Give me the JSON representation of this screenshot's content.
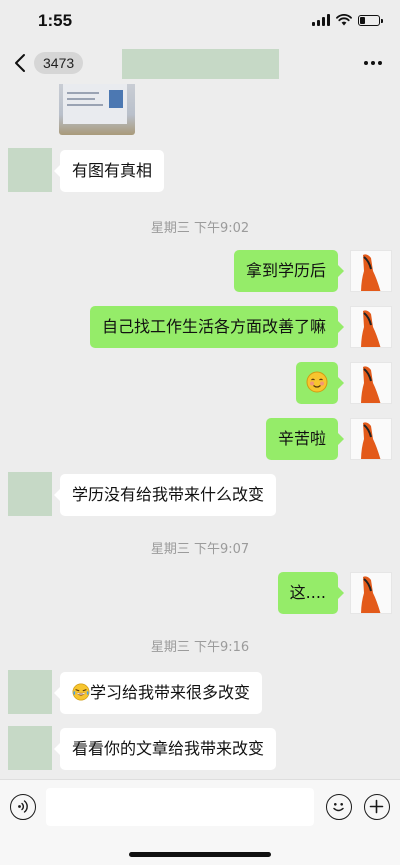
{
  "status_bar": {
    "time": "1:55",
    "battery_level": 0.3
  },
  "nav": {
    "unread_count": "3473"
  },
  "colors": {
    "background": "#ededed",
    "bubble_outgoing": "#95ec69",
    "bubble_incoming": "#ffffff",
    "redacted_block": "#c6d9c6",
    "timestamp_text": "#9b9b9b"
  },
  "messages": [
    {
      "side": "in",
      "type": "image"
    },
    {
      "side": "in",
      "type": "text",
      "text": "有图有真相"
    },
    {
      "type": "timestamp",
      "text": "星期三 下午9:02"
    },
    {
      "side": "out",
      "type": "text",
      "text": "拿到学历后"
    },
    {
      "side": "out",
      "type": "text",
      "text": "自己找工作生活各方面改善了嘛"
    },
    {
      "side": "out",
      "type": "emoji",
      "icon": "blush-smile-emoji"
    },
    {
      "side": "out",
      "type": "text",
      "text": "辛苦啦"
    },
    {
      "side": "in",
      "type": "text",
      "text": "学历没有给我带来什么改变"
    },
    {
      "type": "timestamp",
      "text": "星期三 下午9:07"
    },
    {
      "side": "out",
      "type": "text",
      "text": "这...."
    },
    {
      "type": "timestamp",
      "text": "星期三 下午9:16"
    },
    {
      "side": "in",
      "type": "text",
      "icon": "tears-of-joy-emoji",
      "text": "学习给我带来很多改变"
    },
    {
      "side": "in",
      "type": "text",
      "text": "看看你的文章给我带来改变"
    }
  ],
  "input_bar": {
    "value": "",
    "icons": [
      "voice-icon",
      "emoji-icon",
      "plus-icon"
    ]
  }
}
